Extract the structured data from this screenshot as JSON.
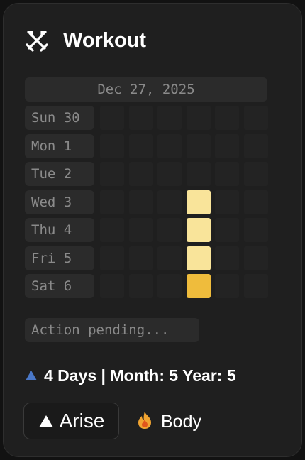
{
  "widget": {
    "title": "Workout",
    "icon": "crossed-swords-icon"
  },
  "calendar": {
    "date_header": "Dec 27, 2025",
    "rows": [
      {
        "label": "Sun 30",
        "fills": [
          0,
          0,
          0,
          0,
          0,
          0
        ]
      },
      {
        "label": "Mon 1",
        "fills": [
          0,
          0,
          0,
          0,
          0,
          0
        ]
      },
      {
        "label": "Tue 2",
        "fills": [
          0,
          0,
          0,
          0,
          0,
          0
        ]
      },
      {
        "label": "Wed 3",
        "fills": [
          0,
          0,
          0,
          1,
          0,
          0
        ]
      },
      {
        "label": "Thu 4",
        "fills": [
          0,
          0,
          0,
          1,
          0,
          0
        ]
      },
      {
        "label": "Fri 5",
        "fills": [
          0,
          0,
          0,
          1,
          0,
          0
        ]
      },
      {
        "label": "Sat 6",
        "fills": [
          0,
          0,
          0,
          2,
          0,
          0
        ]
      }
    ],
    "colors": {
      "empty": "#232323",
      "light": "#f9e49a",
      "strong": "#efbc3c"
    }
  },
  "status": {
    "text": "Action pending..."
  },
  "streak": {
    "text": "4 Days | Month: 5 Year: 5",
    "icon": "triangle-up-icon",
    "icon_color": "#4a78c8"
  },
  "actions": {
    "arise_label": "Arise",
    "tag_label": "Body",
    "tag_icon": "flame-icon"
  }
}
